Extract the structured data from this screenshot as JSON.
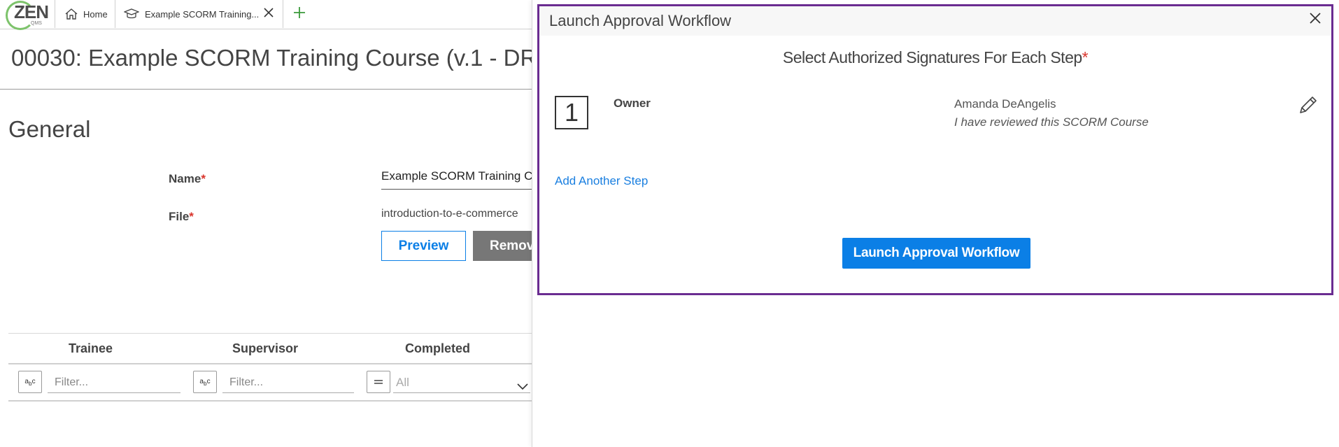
{
  "logo": {
    "name": "ZEN",
    "sub": "QMS"
  },
  "tabs": {
    "home_label": "Home",
    "course_label": "Example SCORM Training..."
  },
  "page": {
    "title": "00030: Example SCORM Training Course (v.1 - DRA",
    "section": "General",
    "name_label": "Name",
    "name_value": "Example SCORM Training Co",
    "file_label": "File",
    "file_value": "introduction-to-e-commerce",
    "preview_label": "Preview",
    "remove_label": "Remov",
    "required_mark": "*"
  },
  "grid": {
    "columns": [
      "Trainee",
      "Supervisor",
      "Completed"
    ],
    "filter_placeholder": "Filter...",
    "completed_value": "All"
  },
  "dialog": {
    "title": "Launch Approval Workflow",
    "subtitle": "Select Authorized Signatures For Each Step",
    "required_mark": "*",
    "steps": [
      {
        "number": "1",
        "role": "Owner",
        "signer": "Amanda DeAngelis",
        "statement": "I have reviewed this SCORM Course"
      }
    ],
    "add_step_label": "Add Another Step",
    "launch_label": "Launch Approval Workflow"
  },
  "colors": {
    "accent": "#0b7fe6",
    "dialog_border": "#6a2c91",
    "required": "#d9342b",
    "logo_green": "#7dc36b"
  }
}
